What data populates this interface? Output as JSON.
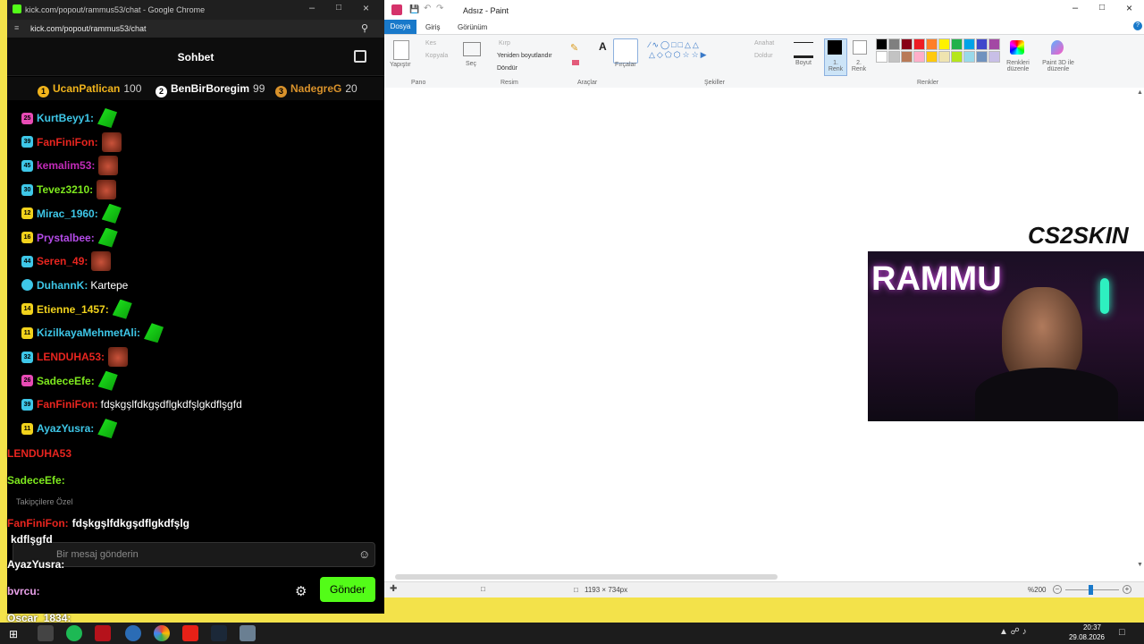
{
  "chrome": {
    "title": "kick.com/popout/rammus53/chat - Google Chrome",
    "url": "kick.com/popout/rammus53/chat"
  },
  "chat": {
    "header": "Sohbet",
    "leaderboard": [
      {
        "rank": "1",
        "name": "UcanPatlican",
        "score": "100",
        "color": "#f1b41c"
      },
      {
        "rank": "2",
        "name": "BenBirBoregim",
        "score": "99",
        "color": "#ffffff"
      },
      {
        "rank": "3",
        "name": "NadegreG",
        "score": "20",
        "color": "#d9922b"
      }
    ],
    "messages": [
      {
        "user": "KurtBeyy1:",
        "color": "#3ec7e8",
        "text": "",
        "badge": "25"
      },
      {
        "user": "FanFiniFon:",
        "color": "#e8251f",
        "text": "",
        "badge": "39"
      },
      {
        "user": "kemalim53:",
        "color": "#c22bb8",
        "text": "",
        "badge": "45"
      },
      {
        "user": "Tevez3210:",
        "color": "#7ee81e",
        "text": "",
        "badge": "30"
      },
      {
        "user": "Mirac_1960:",
        "color": "#3ec7e8",
        "text": "",
        "badge": "12"
      },
      {
        "user": "Prystalbee:",
        "color": "#b44be8",
        "text": "",
        "badge": "16"
      },
      {
        "user": "Seren_49:",
        "color": "#e8251f",
        "text": "",
        "badge": "44"
      },
      {
        "user": "DuhannK:",
        "color": "#3ec7e8",
        "text": "Kartepe",
        "badge": ""
      },
      {
        "user": "Etienne_1457:",
        "color": "#f1d21c",
        "text": "",
        "badge": "14"
      },
      {
        "user": "KizilkayaMehmetAli:",
        "color": "#3ec7e8",
        "text": "",
        "badge": "11"
      },
      {
        "user": "LENDUHA53:",
        "color": "#e8251f",
        "text": "",
        "badge": "32"
      },
      {
        "user": "SadeceEfe:",
        "color": "#7ee81e",
        "text": "",
        "badge": "26"
      },
      {
        "user": "FanFiniFon:",
        "color": "#e8251f",
        "text": "fdşkgşlfdkgşdflgkdfşlgkdflşgfd",
        "badge": "39"
      },
      {
        "user": "AyazYusra:",
        "color": "#3ec7e8",
        "text": "",
        "badge": "11"
      }
    ],
    "overlay_messages": [
      {
        "user": "LENDUHA53",
        "color": "#e8251f",
        "text": ""
      },
      {
        "user": "SadeceEfe:",
        "color": "#7ee81e",
        "text": ""
      },
      {
        "user": "FanFiniFon:",
        "color": "#e8251f",
        "text": "fdşkgşlfdkgşdflgkdfşlg"
      },
      {
        "user": "",
        "color": "#ffffff",
        "text": "kdflşgfd"
      },
      {
        "user": "AyazYusra:",
        "color": "#ffffff",
        "text": ""
      },
      {
        "user": "bvrcu:",
        "color": "#e8a0e8",
        "text": ""
      },
      {
        "user": "Oscar_1834:",
        "color": "#ffffff",
        "text": ""
      }
    ],
    "subscribers_only": "Takipçilere Özel",
    "input_placeholder": "Bir mesaj gönderin",
    "send_label": "Gönder"
  },
  "paint": {
    "title": "Adsız - Paint",
    "tabs": [
      "Dosya",
      "Giriş",
      "Görünüm"
    ],
    "clipboard": {
      "paste": "Yapıştır",
      "cut": "Kes",
      "copy": "Kopyala"
    },
    "image": {
      "select": "Seç",
      "crop": "Kırp",
      "resize": "Yeniden boyutlandır",
      "rotate": "Döndür"
    },
    "brushes": "Fırçalar",
    "outline": "Anahat",
    "fill": "Doldur",
    "size": "Boyut",
    "color1": "1. Renk",
    "color2": "2. Renk",
    "edit_colors": "Renkleri düzenle",
    "paint3d": "Paint 3D ile düzenle",
    "groups": [
      "Pano",
      "Resim",
      "Araçlar",
      "Şekiller",
      "Renkler"
    ],
    "status_size": "1193 × 734px",
    "zoom": "%200"
  },
  "overlay": {
    "sponsor": "CS2SKIN",
    "banner": "RAMMU"
  },
  "taskbar": {
    "time": "20:37",
    "date": "29.08.2026"
  },
  "colors": {
    "palette_row1": [
      "#000000",
      "#7f7f7f",
      "#880015",
      "#ed1c24",
      "#ff7f27",
      "#fff200",
      "#22b14c",
      "#00a2e8",
      "#3f48cc",
      "#a349a4"
    ],
    "palette_row2": [
      "#ffffff",
      "#c3c3c3",
      "#b97a57",
      "#ffaec9",
      "#ffc90e",
      "#efe4b0",
      "#b5e61d",
      "#99d9ea",
      "#7092be",
      "#c8bfe7"
    ],
    "kick_green": "#53fc18"
  }
}
